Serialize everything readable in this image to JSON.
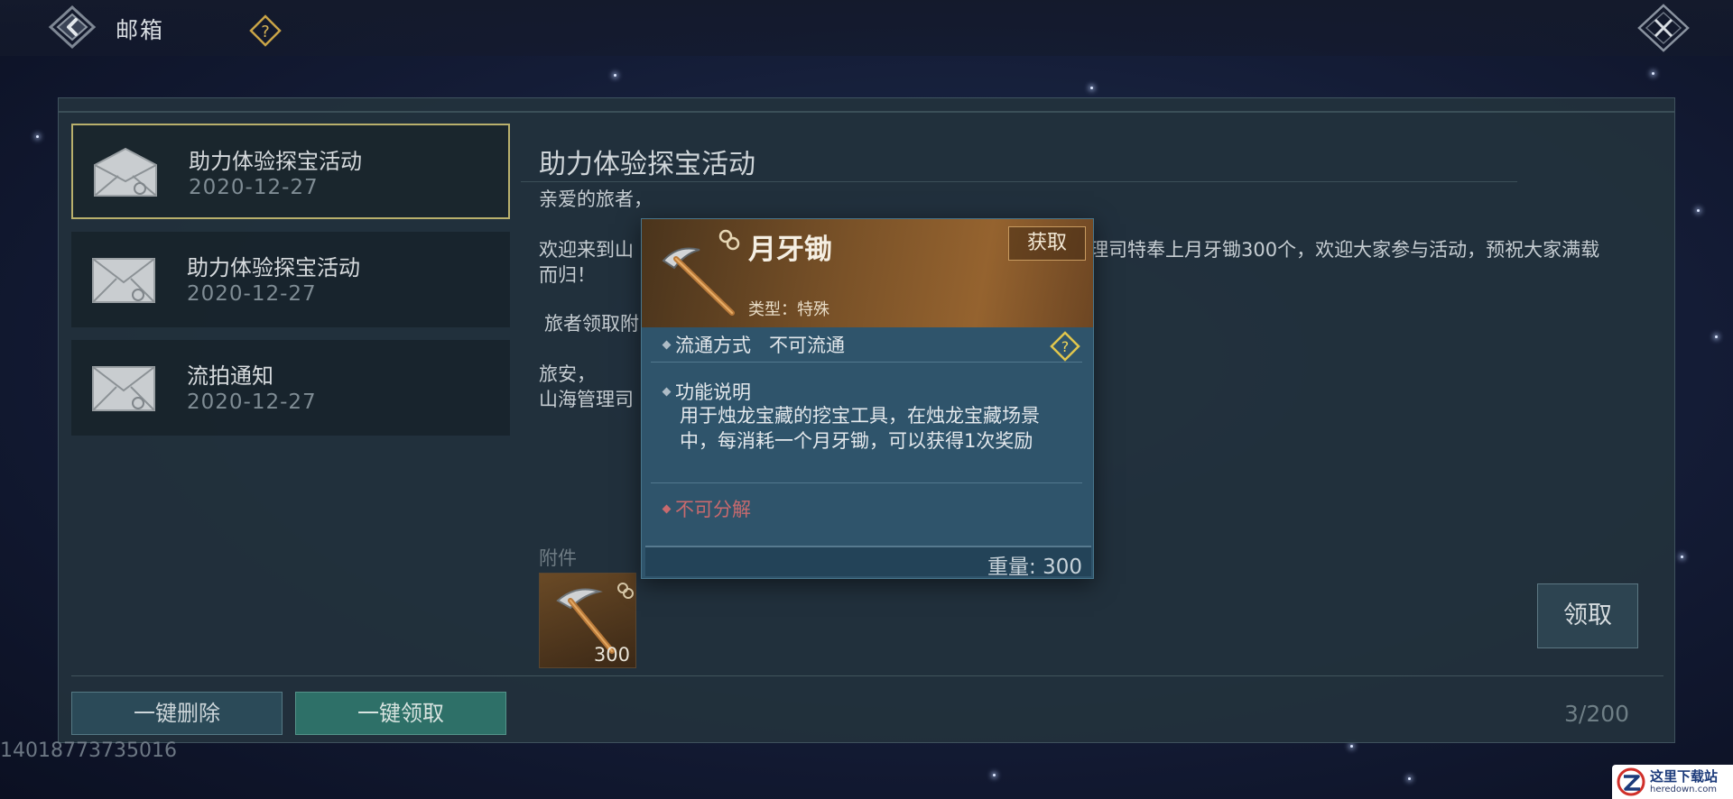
{
  "header": {
    "title": "邮箱"
  },
  "mail_list": [
    {
      "title": "助力体验探宝活动",
      "date": "2020-12-27",
      "selected": true
    },
    {
      "title": "助力体验探宝活动",
      "date": "2020-12-27",
      "selected": false
    },
    {
      "title": "流拍通知",
      "date": "2020-12-27",
      "selected": false
    }
  ],
  "mail_content": {
    "title": "助力体验探宝活动",
    "greeting": "亲爱的旅者，",
    "body_line1_left": "欢迎来到山",
    "body_line1_right": "理司特奉上月牙锄300个，欢迎大家参与活动，预祝大家满载",
    "body_line2": "而归！",
    "body_line3": "旅者领取附",
    "closing": "旅安，",
    "signature": "山海管理司"
  },
  "attachments": {
    "label": "附件",
    "items": [
      {
        "name": "月牙锄",
        "count": "300"
      }
    ]
  },
  "claim_button": "领取",
  "footer": {
    "delete_all": "一键删除",
    "claim_all": "一键领取",
    "count": "3/200"
  },
  "user_id": "14018773735016",
  "tooltip": {
    "item_name": "月牙锄",
    "get_button": "获取",
    "type": "类型：特殊",
    "circulation_label": "流通方式",
    "circulation_value": "不可流通",
    "function_label": "功能说明",
    "function_desc": "用于烛龙宝藏的挖宝工具，在烛龙宝藏场景中，每消耗一个月牙锄，可以获得1次奖励",
    "decompose": "不可分解",
    "weight": "重量: 300"
  },
  "watermark": {
    "title": "这里下载站",
    "url": "heredown.com"
  },
  "colors": {
    "accent_gold": "#b9b06c",
    "claim_all_green": "#30786e",
    "decompose_red": "#c86a6e",
    "tooltip_header": "#7a5228"
  }
}
